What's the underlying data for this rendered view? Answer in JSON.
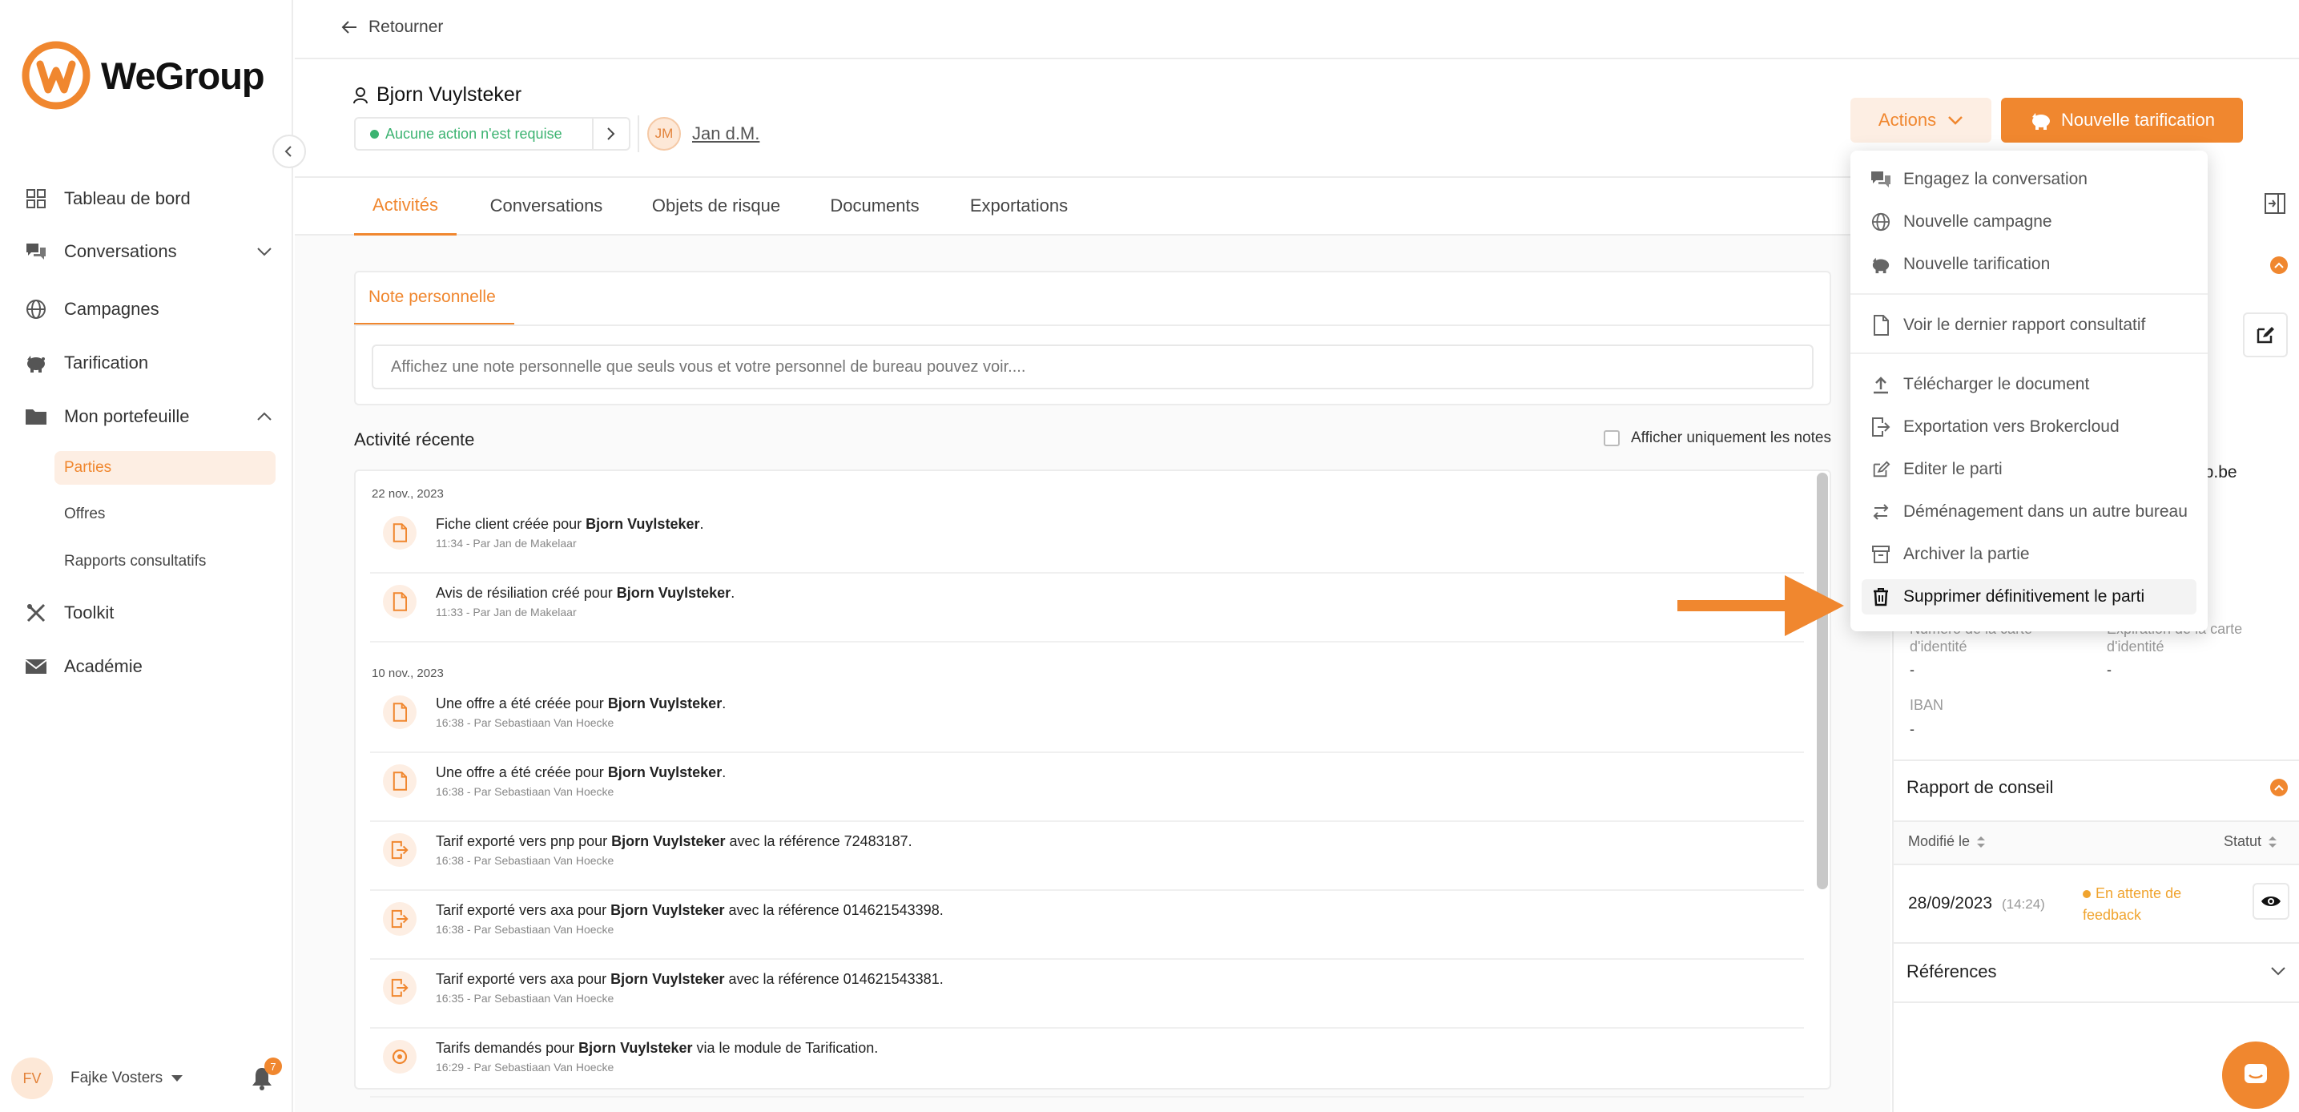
{
  "brand": {
    "name": "WeGroup",
    "accent": "#f0872f"
  },
  "topbar": {
    "back_label": "Retourner"
  },
  "sidebar": {
    "items": [
      {
        "label": "Tableau de bord",
        "icon": "dashboard-icon"
      },
      {
        "label": "Conversations",
        "icon": "chat-icon"
      },
      {
        "label": "Campagnes",
        "icon": "globe-icon"
      },
      {
        "label": "Tarification",
        "icon": "piggy-icon"
      },
      {
        "label": "Mon portefeuille",
        "icon": "folder-icon"
      },
      {
        "label": "Toolkit",
        "icon": "tools-icon"
      },
      {
        "label": "Académie",
        "icon": "mail-icon"
      }
    ],
    "subitems": [
      {
        "label": "Parties",
        "active": true
      },
      {
        "label": "Offres"
      },
      {
        "label": "Rapports consultatifs"
      }
    ],
    "user": {
      "initials": "FV",
      "name": "Fajke Vosters",
      "notifications": "7"
    }
  },
  "client": {
    "name": "Bjorn Vuylsteker",
    "status": "Aucune action n'est requise",
    "agent_initials": "JM",
    "agent_name": "Jan d.M."
  },
  "header_buttons": {
    "actions": "Actions",
    "new_tarif": "Nouvelle tarification"
  },
  "tabs": [
    "Activités",
    "Conversations",
    "Objets de risque",
    "Documents",
    "Exportations"
  ],
  "note": {
    "tab": "Note personnelle",
    "placeholder": "Affichez une note personnelle que seuls vous et votre personnel de bureau pouvez voir...."
  },
  "activity": {
    "title": "Activité récente",
    "only_notes": "Afficher uniquement les notes",
    "groups": [
      {
        "date": "22 nov., 2023",
        "rows": [
          {
            "pre": "Fiche client créée pour ",
            "bold": "Bjorn Vuylsteker",
            "post": ".",
            "sub": "11:34 - Par Jan de Makelaar",
            "icon": "document-icon"
          },
          {
            "pre": "Avis de résiliation créé pour ",
            "bold": "Bjorn Vuylsteker",
            "post": ".",
            "sub": "11:33 - Par Jan de Makelaar",
            "icon": "document-icon"
          }
        ]
      },
      {
        "date": "10 nov., 2023",
        "rows": [
          {
            "pre": "Une offre a été créée pour ",
            "bold": "Bjorn Vuylsteker",
            "post": ".",
            "sub": "16:38 - Par Sebastiaan Van Hoecke",
            "icon": "document-icon"
          },
          {
            "pre": "Une offre a été créée pour ",
            "bold": "Bjorn Vuylsteker",
            "post": ".",
            "sub": "16:38 - Par Sebastiaan Van Hoecke",
            "icon": "document-icon"
          },
          {
            "pre": "Tarif exporté vers pnp pour ",
            "bold": "Bjorn Vuylsteker",
            "post": " avec la référence 72483187.",
            "sub": "16:38 - Par Sebastiaan Van Hoecke",
            "icon": "export-icon"
          },
          {
            "pre": "Tarif exporté vers axa pour ",
            "bold": "Bjorn Vuylsteker",
            "post": " avec la référence 014621543398.",
            "sub": "16:38 - Par Sebastiaan Van Hoecke",
            "icon": "export-icon"
          },
          {
            "pre": "Tarif exporté vers axa pour ",
            "bold": "Bjorn Vuylsteker",
            "post": " avec la référence 014621543381.",
            "sub": "16:35 - Par Sebastiaan Van Hoecke",
            "icon": "export-icon"
          },
          {
            "pre": "Tarifs demandés pour ",
            "bold": "Bjorn Vuylsteker",
            "post": " via le module de Tarification.",
            "sub": "16:29 - Par Sebastiaan Van Hoecke",
            "icon": "refresh-icon"
          }
        ]
      }
    ]
  },
  "right_panel": {
    "email_fragment": "up.be",
    "id_number_label": "Numéro de la carte d'identité",
    "id_number_value": "-",
    "id_expiry_label": "Expiration de la carte d'identité",
    "id_expiry_value": "-",
    "iban_label": "IBAN",
    "iban_value": "-",
    "advice_title": "Rapport de conseil",
    "col_modified": "Modifié le",
    "col_status": "Statut",
    "row_date": "28/09/2023",
    "row_time": "(14:24)",
    "row_status": "En attente de feedback",
    "references_title": "Références"
  },
  "dropdown": {
    "items": [
      {
        "label": "Engagez la conversation",
        "icon": "chat-icon"
      },
      {
        "label": "Nouvelle campagne",
        "icon": "globe-icon"
      },
      {
        "label": "Nouvelle tarification",
        "icon": "piggy-icon"
      },
      {
        "label": "Voir le dernier rapport consultatif",
        "icon": "document-icon"
      },
      {
        "label": "Télécharger le document",
        "icon": "upload-icon"
      },
      {
        "label": "Exportation vers Brokercloud",
        "icon": "export-icon"
      },
      {
        "label": "Editer le parti",
        "icon": "edit-icon"
      },
      {
        "label": "Déménagement dans un autre bureau",
        "icon": "transfer-icon"
      },
      {
        "label": "Archiver la partie",
        "icon": "archive-icon"
      },
      {
        "label": "Supprimer définitivement le parti",
        "icon": "trash-icon",
        "hover": true
      }
    ]
  }
}
